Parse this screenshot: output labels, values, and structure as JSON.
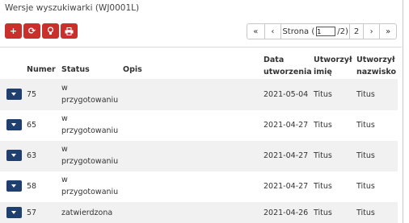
{
  "panel": {
    "title": "Wersje wyszukiwarki (WJ0001L)"
  },
  "toolbar": {
    "buttons": [
      {
        "name": "add-button",
        "icon": "plus-icon",
        "glyph": "+"
      },
      {
        "name": "refresh-button",
        "icon": "refresh-icon",
        "glyph": "⟳"
      },
      {
        "name": "lightbulb-button",
        "icon": "lightbulb-icon",
        "glyph": "♀"
      },
      {
        "name": "print-button",
        "icon": "print-icon",
        "glyph": "⎙"
      }
    ],
    "accent": "#c9302c"
  },
  "pager": {
    "first": "«",
    "prev": "‹",
    "page_label": "Strona (",
    "page_value": "1",
    "total": "/2)",
    "page_number": "2",
    "next": "›",
    "last": "»"
  },
  "table": {
    "headers": {
      "numer": "Numer",
      "status": "Status",
      "opis": "Opis",
      "data_line1": "Data",
      "data_line2": "utworzenia",
      "imie_line1": "Utworzył",
      "imie_line2": "imię",
      "nazwisko_line1": "Utworzył",
      "nazwisko_line2": "nazwisko"
    },
    "rows": [
      {
        "numer": "75",
        "status_line1": "w",
        "status_line2": "przygotowaniu",
        "opis": "",
        "data": "2021-05-04",
        "imie": "Titus",
        "nazwisko": "Titus"
      },
      {
        "numer": "65",
        "status_line1": "w",
        "status_line2": "przygotowaniu",
        "opis": "",
        "data": "2021-04-27",
        "imie": "Titus",
        "nazwisko": "Titus"
      },
      {
        "numer": "63",
        "status_line1": "w",
        "status_line2": "przygotowaniu",
        "opis": "",
        "data": "2021-04-27",
        "imie": "Titus",
        "nazwisko": "Titus"
      },
      {
        "numer": "58",
        "status_line1": "w",
        "status_line2": "przygotowaniu",
        "opis": "",
        "data": "2021-04-27",
        "imie": "Titus",
        "nazwisko": "Titus"
      },
      {
        "numer": "57",
        "status_line1": "zatwierdzona",
        "status_line2": "",
        "opis": "",
        "data": "2021-04-26",
        "imie": "Titus",
        "nazwisko": "Titus"
      }
    ],
    "expand_button_color": "#1f3f6e"
  }
}
